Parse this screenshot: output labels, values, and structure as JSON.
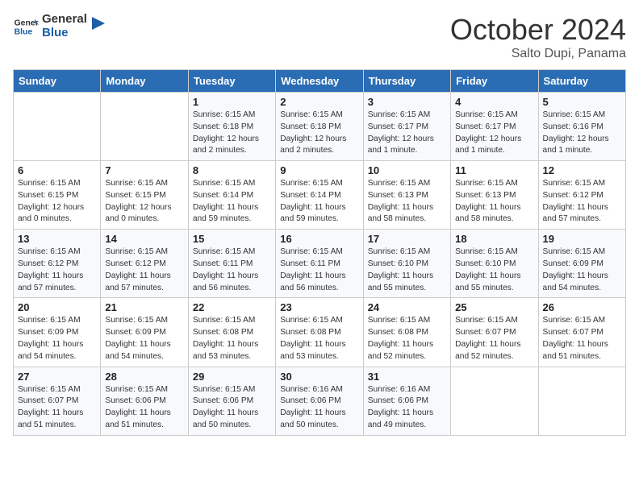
{
  "header": {
    "logo_general": "General",
    "logo_blue": "Blue",
    "month": "October 2024",
    "location": "Salto Dupi, Panama"
  },
  "days_of_week": [
    "Sunday",
    "Monday",
    "Tuesday",
    "Wednesday",
    "Thursday",
    "Friday",
    "Saturday"
  ],
  "weeks": [
    [
      {
        "day": "",
        "info": ""
      },
      {
        "day": "",
        "info": ""
      },
      {
        "day": "1",
        "info": "Sunrise: 6:15 AM\nSunset: 6:18 PM\nDaylight: 12 hours and 2 minutes."
      },
      {
        "day": "2",
        "info": "Sunrise: 6:15 AM\nSunset: 6:18 PM\nDaylight: 12 hours and 2 minutes."
      },
      {
        "day": "3",
        "info": "Sunrise: 6:15 AM\nSunset: 6:17 PM\nDaylight: 12 hours and 1 minute."
      },
      {
        "day": "4",
        "info": "Sunrise: 6:15 AM\nSunset: 6:17 PM\nDaylight: 12 hours and 1 minute."
      },
      {
        "day": "5",
        "info": "Sunrise: 6:15 AM\nSunset: 6:16 PM\nDaylight: 12 hours and 1 minute."
      }
    ],
    [
      {
        "day": "6",
        "info": "Sunrise: 6:15 AM\nSunset: 6:15 PM\nDaylight: 12 hours and 0 minutes."
      },
      {
        "day": "7",
        "info": "Sunrise: 6:15 AM\nSunset: 6:15 PM\nDaylight: 12 hours and 0 minutes."
      },
      {
        "day": "8",
        "info": "Sunrise: 6:15 AM\nSunset: 6:14 PM\nDaylight: 11 hours and 59 minutes."
      },
      {
        "day": "9",
        "info": "Sunrise: 6:15 AM\nSunset: 6:14 PM\nDaylight: 11 hours and 59 minutes."
      },
      {
        "day": "10",
        "info": "Sunrise: 6:15 AM\nSunset: 6:13 PM\nDaylight: 11 hours and 58 minutes."
      },
      {
        "day": "11",
        "info": "Sunrise: 6:15 AM\nSunset: 6:13 PM\nDaylight: 11 hours and 58 minutes."
      },
      {
        "day": "12",
        "info": "Sunrise: 6:15 AM\nSunset: 6:12 PM\nDaylight: 11 hours and 57 minutes."
      }
    ],
    [
      {
        "day": "13",
        "info": "Sunrise: 6:15 AM\nSunset: 6:12 PM\nDaylight: 11 hours and 57 minutes."
      },
      {
        "day": "14",
        "info": "Sunrise: 6:15 AM\nSunset: 6:12 PM\nDaylight: 11 hours and 57 minutes."
      },
      {
        "day": "15",
        "info": "Sunrise: 6:15 AM\nSunset: 6:11 PM\nDaylight: 11 hours and 56 minutes."
      },
      {
        "day": "16",
        "info": "Sunrise: 6:15 AM\nSunset: 6:11 PM\nDaylight: 11 hours and 56 minutes."
      },
      {
        "day": "17",
        "info": "Sunrise: 6:15 AM\nSunset: 6:10 PM\nDaylight: 11 hours and 55 minutes."
      },
      {
        "day": "18",
        "info": "Sunrise: 6:15 AM\nSunset: 6:10 PM\nDaylight: 11 hours and 55 minutes."
      },
      {
        "day": "19",
        "info": "Sunrise: 6:15 AM\nSunset: 6:09 PM\nDaylight: 11 hours and 54 minutes."
      }
    ],
    [
      {
        "day": "20",
        "info": "Sunrise: 6:15 AM\nSunset: 6:09 PM\nDaylight: 11 hours and 54 minutes."
      },
      {
        "day": "21",
        "info": "Sunrise: 6:15 AM\nSunset: 6:09 PM\nDaylight: 11 hours and 54 minutes."
      },
      {
        "day": "22",
        "info": "Sunrise: 6:15 AM\nSunset: 6:08 PM\nDaylight: 11 hours and 53 minutes."
      },
      {
        "day": "23",
        "info": "Sunrise: 6:15 AM\nSunset: 6:08 PM\nDaylight: 11 hours and 53 minutes."
      },
      {
        "day": "24",
        "info": "Sunrise: 6:15 AM\nSunset: 6:08 PM\nDaylight: 11 hours and 52 minutes."
      },
      {
        "day": "25",
        "info": "Sunrise: 6:15 AM\nSunset: 6:07 PM\nDaylight: 11 hours and 52 minutes."
      },
      {
        "day": "26",
        "info": "Sunrise: 6:15 AM\nSunset: 6:07 PM\nDaylight: 11 hours and 51 minutes."
      }
    ],
    [
      {
        "day": "27",
        "info": "Sunrise: 6:15 AM\nSunset: 6:07 PM\nDaylight: 11 hours and 51 minutes."
      },
      {
        "day": "28",
        "info": "Sunrise: 6:15 AM\nSunset: 6:06 PM\nDaylight: 11 hours and 51 minutes."
      },
      {
        "day": "29",
        "info": "Sunrise: 6:15 AM\nSunset: 6:06 PM\nDaylight: 11 hours and 50 minutes."
      },
      {
        "day": "30",
        "info": "Sunrise: 6:16 AM\nSunset: 6:06 PM\nDaylight: 11 hours and 50 minutes."
      },
      {
        "day": "31",
        "info": "Sunrise: 6:16 AM\nSunset: 6:06 PM\nDaylight: 11 hours and 49 minutes."
      },
      {
        "day": "",
        "info": ""
      },
      {
        "day": "",
        "info": ""
      }
    ]
  ]
}
